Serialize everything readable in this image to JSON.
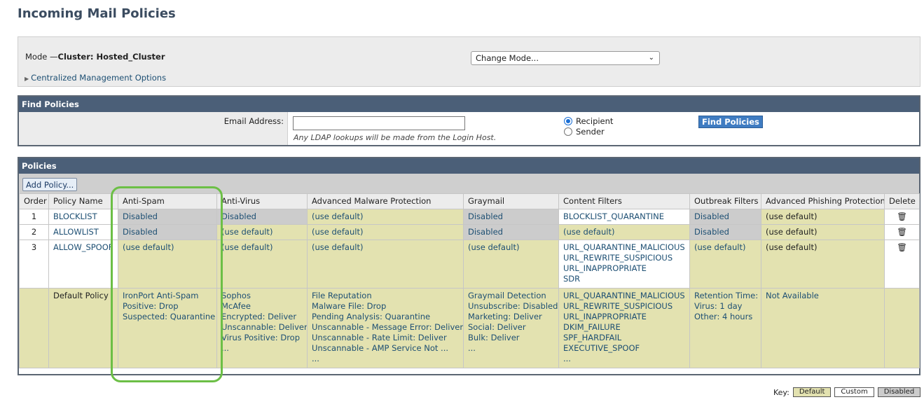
{
  "title": "Incoming Mail Policies",
  "mode": {
    "label": "Mode —",
    "value": "Cluster: Hosted_Cluster",
    "change_mode": "Change Mode...",
    "centralized": "Centralized Management Options"
  },
  "find": {
    "header": "Find Policies",
    "email_label": "Email Address:",
    "email_value": "",
    "hint": "Any LDAP lookups will be made from the Login Host.",
    "recipient": "Recipient",
    "sender": "Sender",
    "button": "Find Policies"
  },
  "policies": {
    "header": "Policies",
    "add_button": "Add Policy...",
    "columns": [
      "Order",
      "Policy Name",
      "Anti-Spam",
      "Anti-Virus",
      "Advanced Malware Protection",
      "Graymail",
      "Content Filters",
      "Outbreak Filters",
      "Advanced Phishing Protection",
      "Delete"
    ],
    "rows": [
      {
        "order": "1",
        "name": "BLOCKLIST",
        "anti_spam": "Disabled",
        "anti_virus": "Disabled",
        "amp": "(use default)",
        "graymail": "Disabled",
        "content_filters": [
          "BLOCKLIST_QUARANTINE"
        ],
        "outbreak": "Disabled",
        "app": "(use default)"
      },
      {
        "order": "2",
        "name": "ALLOWLIST",
        "anti_spam": "Disabled",
        "anti_virus": "(use default)",
        "amp": "(use default)",
        "graymail": "Disabled",
        "content_filters": [
          "(use default)"
        ],
        "outbreak": "Disabled",
        "app": "(use default)"
      },
      {
        "order": "3",
        "name": "ALLOW_SPOOF",
        "anti_spam": "(use default)",
        "anti_virus": "(use default)",
        "amp": "(use default)",
        "graymail": "(use default)",
        "content_filters": [
          "URL_QUARANTINE_MALICIOUS",
          "URL_REWRITE_SUSPICIOUS",
          "URL_INAPPROPRIATE",
          "SDR"
        ],
        "outbreak": "(use default)",
        "app": "(use default)"
      }
    ],
    "default": {
      "name": "Default Policy",
      "anti_spam": [
        "IronPort Anti-Spam",
        "Positive: Drop",
        "Suspected: Quarantine"
      ],
      "anti_virus": [
        "Sophos",
        "McAfee",
        "Encrypted: Deliver",
        "Unscannable: Deliver",
        "Virus Positive: Drop",
        "..."
      ],
      "amp": [
        "File Reputation",
        "Malware File: Drop",
        "Pending Analysis: Quarantine",
        "Unscannable - Message Error: Deliver",
        "Unscannable - Rate Limit: Deliver",
        "Unscannable - AMP Service Not ...",
        "..."
      ],
      "graymail": [
        "Graymail Detection",
        "Unsubscribe: Disabled",
        "Marketing: Deliver",
        "Social: Deliver",
        "Bulk: Deliver",
        "..."
      ],
      "content_filters": [
        "URL_QUARANTINE_MALICIOUS",
        "URL_REWRITE_SUSPICIOUS",
        "URL_INAPPROPRIATE",
        "DKIM_FAILURE",
        "SPF_HARDFAIL",
        "EXECUTIVE_SPOOF",
        "..."
      ],
      "outbreak": [
        "Retention Time:",
        "Virus: 1 day",
        "Other: 4 hours"
      ],
      "app": "Not Available"
    }
  },
  "key": {
    "label": "Key:",
    "default": "Default",
    "custom": "Custom",
    "disabled": "Disabled"
  },
  "colors": {
    "default_cell": "#e3e2b0",
    "disabled_cell": "#cccccc",
    "custom_cell": "#ffffff",
    "header_bar": "#4b5f78",
    "highlight": "#6cbf46"
  }
}
